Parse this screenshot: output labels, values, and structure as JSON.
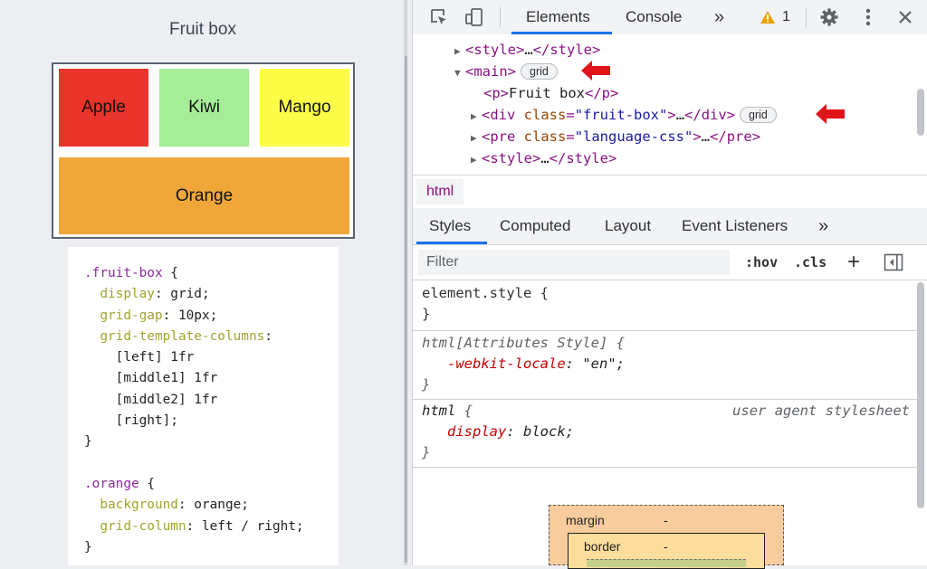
{
  "page": {
    "title": "Fruit box",
    "fruits": [
      "Apple",
      "Kiwi",
      "Mango",
      "Orange"
    ],
    "css_code": [
      [
        {
          "t": ".fruit-box",
          "c": "c-sel"
        },
        {
          "t": " {",
          "c": "c-val"
        }
      ],
      [
        {
          "t": "  display",
          "c": "c-prop"
        },
        {
          "t": ": grid;",
          "c": "c-val"
        }
      ],
      [
        {
          "t": "  grid-gap",
          "c": "c-prop"
        },
        {
          "t": ": 10px;",
          "c": "c-val"
        }
      ],
      [
        {
          "t": "  grid-template-columns",
          "c": "c-prop"
        },
        {
          "t": ":",
          "c": "c-val"
        }
      ],
      [
        {
          "t": "    [left] 1fr",
          "c": "c-val"
        }
      ],
      [
        {
          "t": "    [middle1] 1fr",
          "c": "c-val"
        }
      ],
      [
        {
          "t": "    [middle2] 1fr",
          "c": "c-val"
        }
      ],
      [
        {
          "t": "    [right];",
          "c": "c-val"
        }
      ],
      [
        {
          "t": "}",
          "c": "c-val"
        }
      ],
      [
        {
          "t": "",
          "c": "c-val"
        }
      ],
      [
        {
          "t": ".orange",
          "c": "c-sel"
        },
        {
          "t": " {",
          "c": "c-val"
        }
      ],
      [
        {
          "t": "  background",
          "c": "c-prop"
        },
        {
          "t": ": orange;",
          "c": "c-val"
        }
      ],
      [
        {
          "t": "  grid-column",
          "c": "c-prop"
        },
        {
          "t": ": left / right;",
          "c": "c-val"
        }
      ],
      [
        {
          "t": "}",
          "c": "c-val"
        }
      ]
    ]
  },
  "devtools": {
    "tabs": {
      "elements": "Elements",
      "console": "Console",
      "more": "»"
    },
    "warning_count": "1",
    "dom": {
      "style1": {
        "open": "<style>",
        "ellipsis": "…",
        "close": "</style>"
      },
      "main": {
        "open": "<main>",
        "badge": "grid"
      },
      "p": {
        "open": "<p>",
        "text": "Fruit box",
        "close": "</p>"
      },
      "div": {
        "tag": "<div",
        "attr": "class",
        "val": "\"fruit-box\"",
        "end": ">",
        "ellipsis": "…",
        "close": "</div>",
        "badge": "grid"
      },
      "pre": {
        "tag": "<pre",
        "attr": "class",
        "val": "\"language-css\"",
        "end": ">",
        "ellipsis": "…",
        "close": "</pre>"
      },
      "style2": {
        "open": "<style>",
        "ellipsis": "…",
        "close": "</style>"
      }
    },
    "breadcrumb": "html",
    "styles_tabs": {
      "styles": "Styles",
      "computed": "Computed",
      "layout": "Layout",
      "event_listeners": "Event Listeners",
      "more": "»"
    },
    "filter": {
      "placeholder": "Filter",
      "hov": ":hov",
      "cls": ".cls",
      "plus": "+"
    },
    "rules": {
      "element_style": {
        "selector": "element.style {",
        "close": "}"
      },
      "attributes": {
        "selector": "html[Attributes Style] {",
        "prop": "-webkit-locale",
        "val": "\"en\"",
        "close": "}"
      },
      "ua": {
        "selector": "html",
        "brace": " {",
        "origin": "user agent stylesheet",
        "prop": "display",
        "val": "block",
        "close": "}"
      }
    },
    "box_model": {
      "margin_label": "margin",
      "margin_value": "-",
      "border_label": "border",
      "border_value": "-"
    }
  },
  "colors": {
    "apple": "#e8342a",
    "kiwi": "#a5ee97",
    "mango": "#fdfd47",
    "orange": "#f1a63a",
    "accent": "#1a73e8",
    "arrow": "#e0141b"
  }
}
